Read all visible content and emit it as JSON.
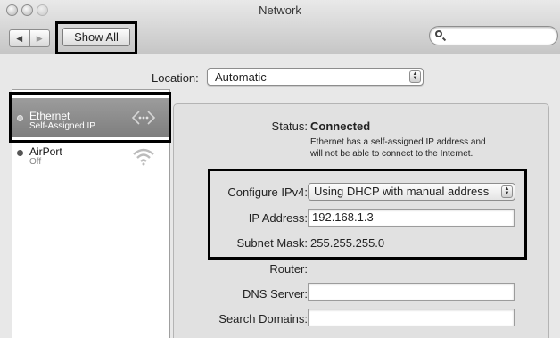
{
  "window": {
    "title": "Network"
  },
  "toolbar": {
    "back_glyph": "◀",
    "forward_glyph": "▶",
    "show_all_label": "Show All",
    "search_placeholder": ""
  },
  "location": {
    "label": "Location:",
    "value": "Automatic"
  },
  "services": [
    {
      "name": "Ethernet",
      "status": "Self-Assigned IP",
      "icon": "ethernet-arrows-icon",
      "selected": true
    },
    {
      "name": "AirPort",
      "status": "Off",
      "icon": "wifi-icon",
      "selected": false
    }
  ],
  "detail": {
    "status_label": "Status:",
    "status_value": "Connected",
    "status_note_line1": "Ethernet has a self-assigned IP address and",
    "status_note_line2": "will not be able to connect to the Internet.",
    "configure_label": "Configure IPv4:",
    "configure_value": "Using DHCP with manual address",
    "ip_label": "IP Address:",
    "ip_value": "192.168.1.3",
    "subnet_label": "Subnet Mask:",
    "subnet_value": "255.255.255.0",
    "router_label": "Router:",
    "router_value": "",
    "dns_label": "DNS Server:",
    "dns_value": "",
    "search_domains_label": "Search Domains:",
    "search_domains_value": ""
  },
  "colors": {
    "highlight_border": "#000000",
    "selected_row": "#8a8a8a",
    "status_off_dot": "#555555"
  }
}
